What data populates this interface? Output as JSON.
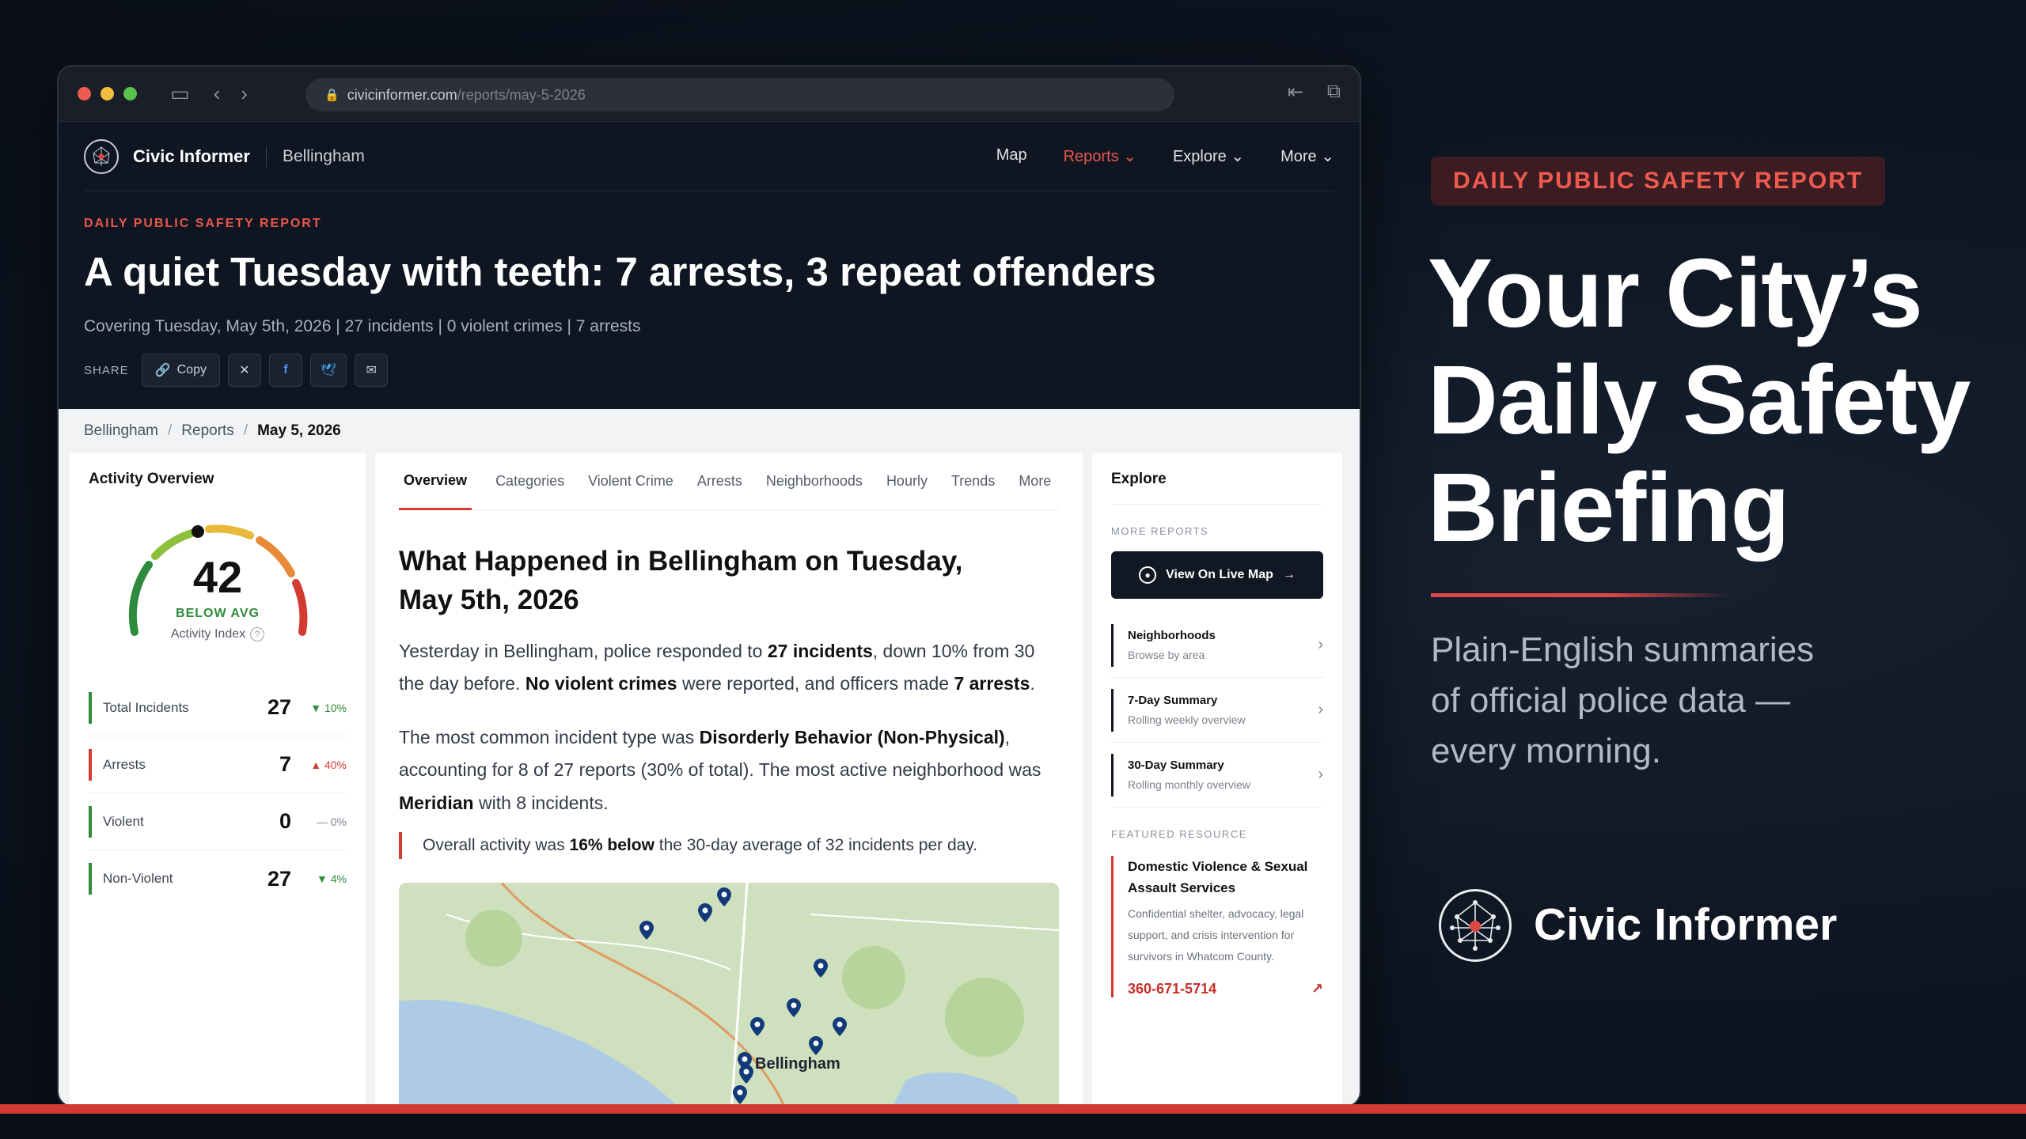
{
  "browser": {
    "url_domain": "civicinformer.com",
    "url_path": "/reports/may-5-2026"
  },
  "site": {
    "brand": "Civic Informer",
    "city": "Bellingham",
    "nav": [
      "Map",
      "Reports",
      "Explore",
      "More"
    ],
    "active_nav": "Reports"
  },
  "hero": {
    "eyebrow": "DAILY PUBLIC SAFETY REPORT",
    "headline": "A quiet Tuesday with teeth: 7 arrests, 3 repeat offenders",
    "subline": "Covering Tuesday, May 5th, 2026 | 27 incidents | 0 violent crimes | 7 arrests",
    "share_label": "SHARE",
    "copy_label": "Copy"
  },
  "breadcrumb": [
    "Bellingham",
    "Reports",
    "May 5, 2026"
  ],
  "activity": {
    "title": "Activity Overview",
    "index_value": "42",
    "index_fraction": 0.42,
    "index_status": "BELOW AVG",
    "index_label": "Activity Index",
    "stats": [
      {
        "label": "Total Incidents",
        "value": "27",
        "change": "▼ 10%",
        "dir": "down",
        "color": "#2e8a3c"
      },
      {
        "label": "Arrests",
        "value": "7",
        "change": "▲ 40%",
        "dir": "up",
        "color": "#d33a32"
      },
      {
        "label": "Violent",
        "value": "0",
        "change": "— 0%",
        "dir": "flat",
        "color": "#2e8a3c"
      },
      {
        "label": "Non-Violent",
        "value": "27",
        "change": "▼ 4%",
        "dir": "down",
        "color": "#2e8a3c"
      }
    ]
  },
  "article": {
    "tabs": [
      "Overview",
      "Categories",
      "Violent Crime",
      "Arrests",
      "Neighborhoods",
      "Hourly",
      "Trends",
      "More"
    ],
    "title_line1": "What Happened in Bellingham on Tuesday,",
    "title_line2": "May 5th, 2026",
    "p1": {
      "t1": "Yesterday in Bellingham, police responded to ",
      "b1": "27 incidents",
      "t2": ", down 10% from 30 the day before. ",
      "b2": "No violent crimes",
      "t3": " were reported, and officers made ",
      "b3": "7 arrests",
      "t4": "."
    },
    "p2": {
      "t1": "The most common incident type was ",
      "b1": "Disorderly Behavior (Non-Physical)",
      "t2": ", accounting for 8 of 27 reports (30% of total). The most active neighborhood was ",
      "b2": "Meridian",
      "t3": " with 8 incidents."
    },
    "callout": {
      "t1": "Overall activity was ",
      "b1": "16% below",
      "t2": " the 30-day average of 32 incidents per day."
    },
    "map_label": "Bellingham"
  },
  "explore": {
    "title": "Explore",
    "more_reports": "MORE REPORTS",
    "live_map_btn": "View On Live Map",
    "items": [
      {
        "title": "Neighborhoods",
        "sub": "Browse by area"
      },
      {
        "title": "7-Day Summary",
        "sub": "Rolling weekly overview"
      },
      {
        "title": "30-Day Summary",
        "sub": "Rolling monthly overview"
      }
    ],
    "featured_label": "FEATURED RESOURCE",
    "featured_title": "Domestic Violence & Sexual Assault Services",
    "featured_desc": "Confidential shelter, advocacy, legal support, and crisis intervention for survivors in Whatcom County.",
    "featured_phone": "360-671-5714"
  },
  "marketing": {
    "badge": "DAILY PUBLIC SAFETY REPORT",
    "title_l1": "Your City’s",
    "title_l2": "Daily Safety",
    "title_l3": "Briefing",
    "sub_l1": "Plain-English summaries",
    "sub_l2": "of official police data —",
    "sub_l3": "every morning.",
    "brand": "Civic Informer"
  },
  "colors": {
    "accent_red": "#d33a32",
    "dark_bg": "#0d1420",
    "green": "#2e8a3c"
  }
}
